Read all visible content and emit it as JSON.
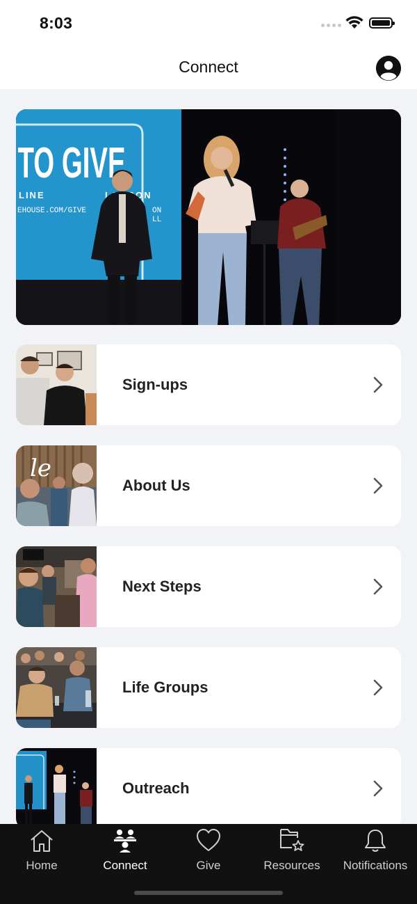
{
  "status_bar": {
    "time": "8:03"
  },
  "nav": {
    "title": "Connect",
    "profile_icon": "person-circle-icon"
  },
  "hero": {
    "screen_text_1": "TO GIVE",
    "screen_text_2": "LINE",
    "screen_text_3": "EHOUSE.COM/GIVE",
    "screen_text_4": "I      ERSON",
    "screen_text_5": "ON",
    "screen_text_6": "LL"
  },
  "menu": {
    "items": [
      {
        "label": "Sign-ups"
      },
      {
        "label": "About Us"
      },
      {
        "label": "Next Steps"
      },
      {
        "label": "Life Groups"
      },
      {
        "label": "Outreach"
      }
    ]
  },
  "tab_bar": {
    "tabs": [
      {
        "label": "Home",
        "icon": "house-icon"
      },
      {
        "label": "Connect",
        "icon": "people-icon",
        "active": true
      },
      {
        "label": "Give",
        "icon": "heart-icon"
      },
      {
        "label": "Resources",
        "icon": "folder-star-icon"
      },
      {
        "label": "Notifications",
        "icon": "bell-icon"
      }
    ]
  },
  "colors": {
    "accent": "#111111",
    "background": "#f2f3f7",
    "card": "#ffffff",
    "tab_bar": "#111111"
  }
}
